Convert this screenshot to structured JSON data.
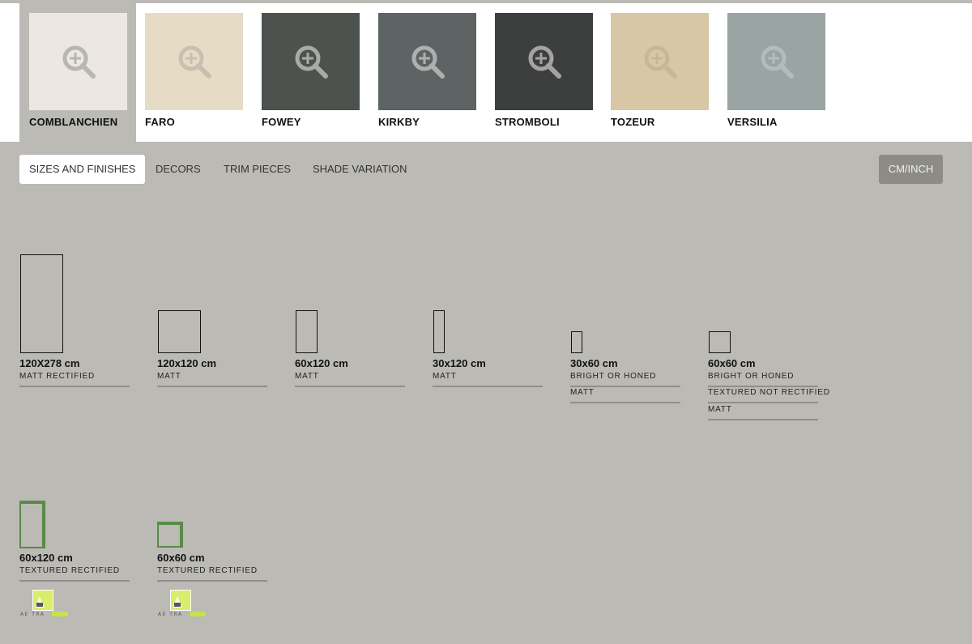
{
  "swatches": [
    {
      "name": "COMBLANCHIEN",
      "color": "#ece8e1",
      "active": true
    },
    {
      "name": "FARO",
      "color": "#e6dcc6",
      "active": false
    },
    {
      "name": "FOWEY",
      "color": "#4d524f",
      "active": false
    },
    {
      "name": "KIRKBY",
      "color": "#5e6363",
      "active": false
    },
    {
      "name": "STROMBOLI",
      "color": "#3d3e3e",
      "active": false
    },
    {
      "name": "TOZEUR",
      "color": "#d8c7a5",
      "active": false
    },
    {
      "name": "VERSILIA",
      "color": "#9aa4a2",
      "active": false
    }
  ],
  "tabs": {
    "sizes": "SIZES AND FINISHES",
    "decors": "DECORS",
    "trim": "TRIM PIECES",
    "shade": "SHADE VARIATION"
  },
  "unit_toggle": "CM/INCH",
  "sizes": [
    {
      "label": "120X278 cm",
      "finishes": [
        "MATT RECTIFIED"
      ]
    },
    {
      "label": "120x120 cm",
      "finishes": [
        "MATT"
      ]
    },
    {
      "label": "60x120 cm",
      "finishes": [
        "MATT"
      ]
    },
    {
      "label": "30x120 cm",
      "finishes": [
        "MATT"
      ]
    },
    {
      "label": "30x60 cm",
      "finishes": [
        "BRIGHT OR HONED",
        "MATT"
      ]
    },
    {
      "label": "60x60 cm",
      "finishes": [
        "BRIGHT OR HONED",
        "TEXTURED NOT RECTIFIED",
        "MATT"
      ]
    }
  ],
  "outdoor_sizes": [
    {
      "label": "60x120 cm",
      "finishes": [
        "TEXTURED RECTIFIED"
      ],
      "badge": "AE TRA"
    },
    {
      "label": "60x60 cm",
      "finishes": [
        "TEXTURED RECTIFIED"
      ],
      "badge": "AE TRA"
    }
  ],
  "colors": {
    "accent_green": "#5a8a46",
    "logo_green": "#c8e04a"
  }
}
